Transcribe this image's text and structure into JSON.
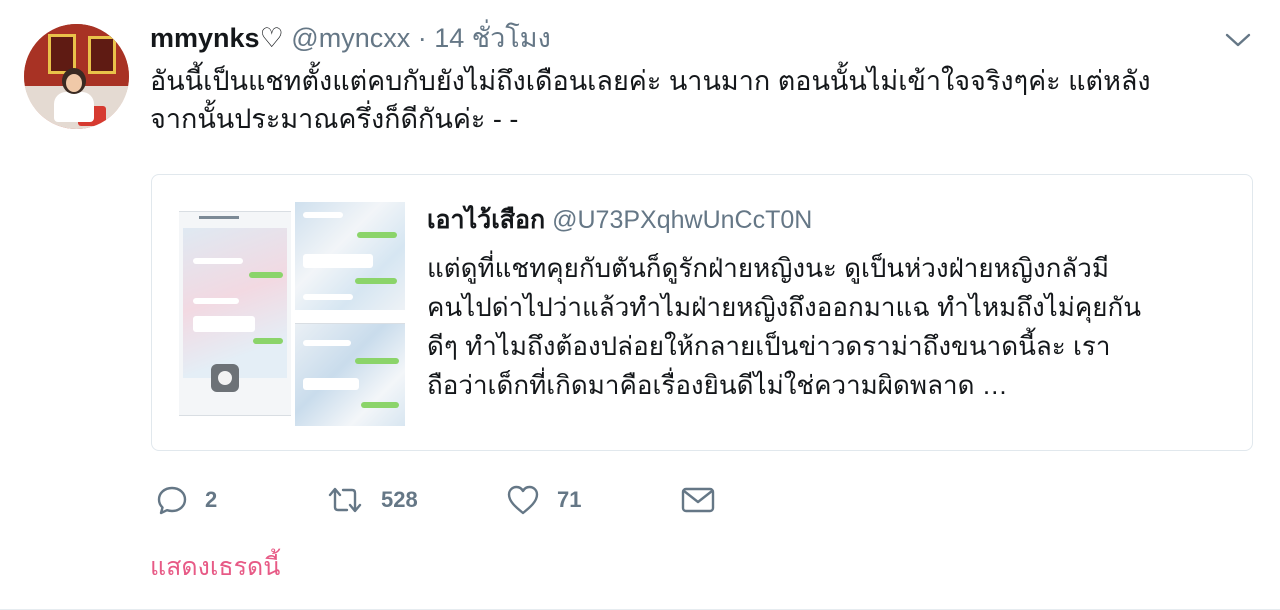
{
  "tweet": {
    "author_name": "mmynks",
    "name_suffix": "♡",
    "handle": "@myncxx",
    "separator": "·",
    "timestamp": "14 ชั่วโมง",
    "text_lines": [
      "อันนี้เป็นแชทตั้งแต่คบกับยังไม่ถึงเดือนเลยค่ะ นานมาก ตอนนั้นไม่เข้าใจจริงๆค่ะ แต่หลัง",
      "จากนั้นประมาณครึ่งก็ดีกันค่ะ - -"
    ],
    "avatar_icon": "profile-photo",
    "caret_icon": "chevron-down-icon"
  },
  "quote": {
    "author_name": "เอาไว้เสือก",
    "handle": "@U73PXqhwUnCcT0N",
    "text_lines": [
      "แต่ดูที่แชทคุยกับตันก็ดูรักฝ่ายหญิงนะ ดูเป็นห่วงฝ่ายหญิงกลัวมี",
      "คนไปด่าไปว่าแล้วทำไมฝ่ายหญิงถึงออกมาแฉ ทำไหมถึงไม่คุยกัน",
      "ดีๆ ทำไมถึงต้องปล่อยให้กลายเป็นข่าวดราม่าถึงขนาดนี้ละ เรา",
      "ถือว่าเด็กที่เกิดมาคือเรื่องยินดีไม่ใช่ความผิดพลาด …"
    ],
    "thumbnail_icon": "chat-screenshots-thumbnail"
  },
  "actions": {
    "reply_count": "2",
    "retweet_count": "528",
    "like_count": "71",
    "icons": [
      "reply-icon",
      "retweet-icon",
      "like-icon",
      "message-icon"
    ]
  },
  "show_thread": "แสดงเธรดนี้",
  "colors": {
    "text_primary": "#14171a",
    "text_secondary": "#657786",
    "border": "#e1e8ed",
    "show_thread": "#e0245e"
  }
}
